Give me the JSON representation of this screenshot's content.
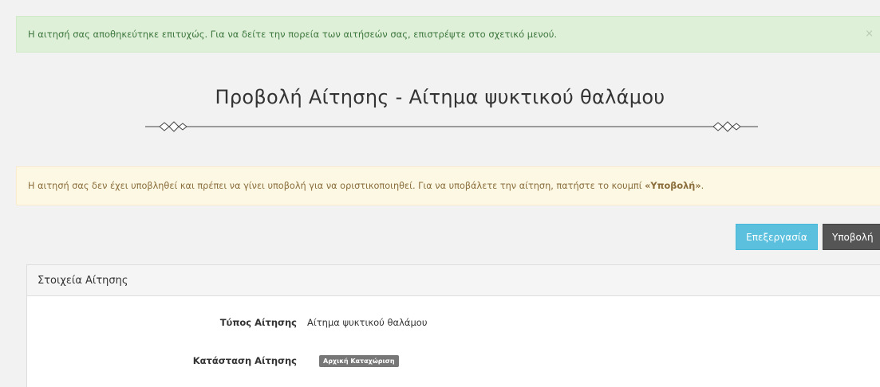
{
  "success_alert": {
    "message": "Η αιτησή σας αποθηκεύτηκε επιτυχώς. Για να δείτε την πορεία των αιτήσεών σας, επιστρέψτε στο σχετικό μενού.",
    "close_symbol": "×"
  },
  "page_title": "Προβολή Αίτησης - Αίτημα ψυκτικού θαλάμου",
  "warning_alert": {
    "message_prefix": "Η αιτησή σας δεν έχει υποβληθεί και πρέπει να γίνει υποβολή για να οριστικοποιηθεί. Για να υποβάλετε την αίτηση, πατήστε το κουμπί ",
    "highlight": "«Υποβολή»",
    "message_suffix": "."
  },
  "actions": {
    "edit_label": "Επεξεργασία",
    "submit_label": "Υποβολή"
  },
  "details_panel": {
    "heading": "Στοιχεία Αίτησης",
    "fields": [
      {
        "label": "Τύπος Αίτησης",
        "value": "Αίτημα ψυκτικού θαλάμου"
      },
      {
        "label": "Κατάσταση Αίτησης",
        "value": "Αρχική Καταχώριση"
      }
    ]
  },
  "colors": {
    "success_bg": "#dff0d8",
    "success_text": "#3c763d",
    "warning_bg": "#fcf8e3",
    "warning_text": "#8a6d3b",
    "edit_button": "#5bc0de",
    "submit_button": "#555555",
    "badge_bg": "#777777"
  }
}
